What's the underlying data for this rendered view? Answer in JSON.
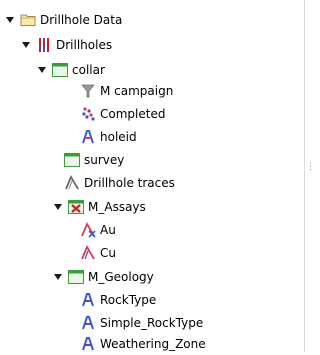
{
  "tree": {
    "drillhole_data": "Drillhole Data",
    "drillholes": "Drillholes",
    "collar": "collar",
    "m_campaign": "M campaign",
    "completed": "Completed",
    "holeid": "holeid",
    "survey": "survey",
    "drillhole_traces": "Drillhole traces",
    "m_assays": "M_Assays",
    "au": "Au",
    "cu": "Cu",
    "m_geology": "M_Geology",
    "rocktype": "RockType",
    "simple_rocktype": "Simple_RockType",
    "weathering_zone": "Weathering_Zone"
  },
  "colors": {
    "folder": "#e8c86a",
    "table_green": "#3c9b3c",
    "assays_red": "#d02020",
    "drillholes_red": "#c0202a",
    "drillholes_purple": "#6a3fb0",
    "line_au": "#d73c5a",
    "line_cu": "#d73c5a",
    "text_icon": "#3a5bd0"
  }
}
